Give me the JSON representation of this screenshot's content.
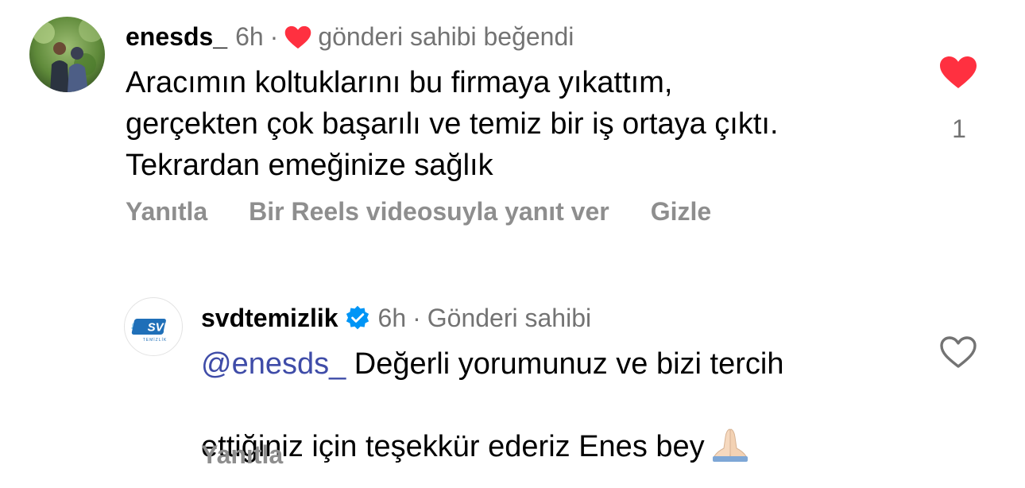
{
  "comments": [
    {
      "username": "enesds_",
      "time": "6h",
      "separator": "·",
      "meta_note": "gönderi sahibi beğendi",
      "text": "Aracımın koltuklarını bu firmaya yıkattım,\ngerçekten çok başarılı ve temiz bir iş ortaya çıktı.\nTekrardan emeğinize sağlık",
      "actions": {
        "reply": "Yanıtla",
        "reels_reply": "Bir Reels videosuyla yanıt ver",
        "hide": "Gizle"
      },
      "liked": true,
      "like_count": "1",
      "avatar_icon": "user-photo-avatar",
      "like_icon": "heart-filled-icon"
    },
    {
      "username": "svdtemizlik",
      "verified": true,
      "time": "6h",
      "separator": "·",
      "meta_note": "Gönderi sahibi",
      "mention": "@enesds_",
      "text": " Değerli yorumunuz ve bizi tercih\nettiğiniz için teşekkür ederiz Enes bey",
      "emoji": "🙏🏻",
      "actions": {
        "reply": "Yanıtla"
      },
      "liked": false,
      "avatar_logo_text": "SVD",
      "avatar_logo_subtext": "TEMİZLİK",
      "like_icon": "heart-outline-icon"
    }
  ],
  "colors": {
    "primary_text": "#000000",
    "secondary_text": "#737373",
    "action_text": "#8e8e8e",
    "like_red": "#ff3040",
    "mention_blue": "#3f4ca8",
    "verified_blue": "#0095f6"
  }
}
